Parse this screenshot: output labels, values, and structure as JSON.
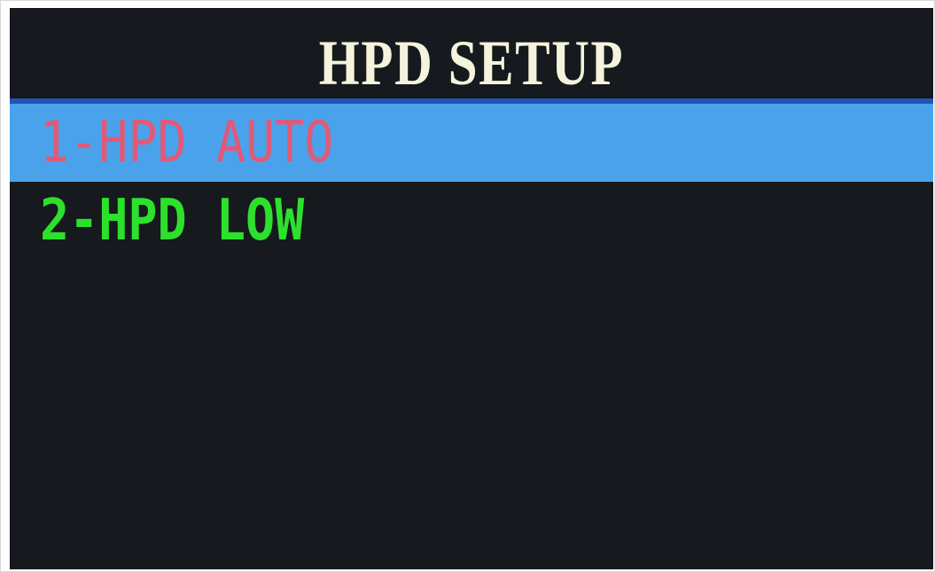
{
  "screen": {
    "title": "HPD SETUP"
  },
  "menu": {
    "items": [
      {
        "label": "1-HPD AUTO",
        "selected": true
      },
      {
        "label": "2-HPD LOW",
        "selected": false
      }
    ]
  },
  "colors": {
    "background": "#16191d",
    "title_text": "#f5f3dc",
    "title_rule": "#1f56b8",
    "selected_bg": "#4aa3ea",
    "selected_text": "#e05a78",
    "unselected_text": "#2de02d"
  }
}
